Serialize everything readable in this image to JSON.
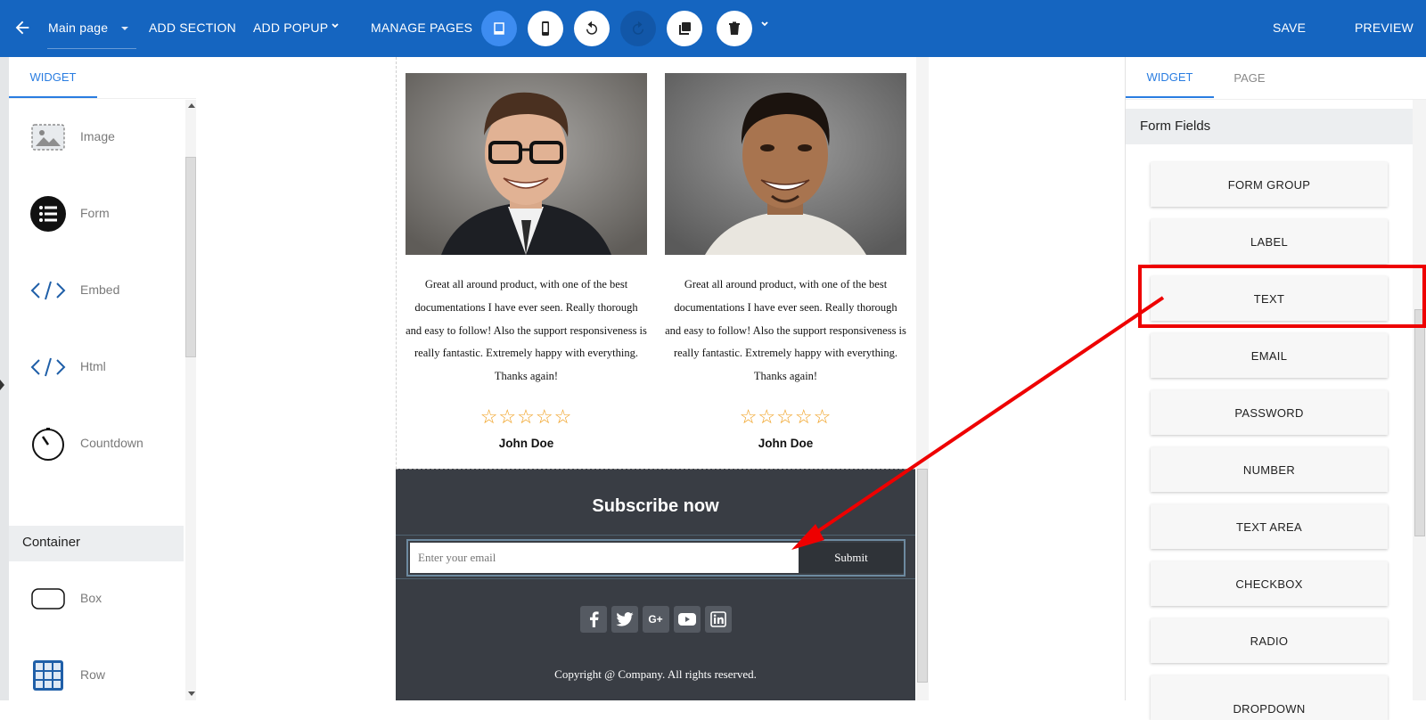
{
  "toolbar": {
    "page_select": "Main page",
    "add_section": "ADD SECTION",
    "add_popup": "ADD POPUP",
    "manage_pages": "MANAGE PAGES",
    "save": "SAVE",
    "preview": "PREVIEW"
  },
  "left_panel": {
    "tab": "WIDGET",
    "widgets": [
      {
        "label": "Image",
        "icon": "image-icon"
      },
      {
        "label": "Form",
        "icon": "form-list-icon"
      },
      {
        "label": "Embed",
        "icon": "code-icon"
      },
      {
        "label": "Html",
        "icon": "code-icon"
      },
      {
        "label": "Countdown",
        "icon": "timer-icon"
      }
    ],
    "container_heading": "Container",
    "container_items": [
      {
        "label": "Box",
        "icon": "box-icon"
      },
      {
        "label": "Row",
        "icon": "grid-icon"
      }
    ]
  },
  "canvas": {
    "testimonials": [
      {
        "text": "Great all around product, with one of the best documentations I have ever seen. Really thorough and easy to follow! Also the support responsiveness is really fantastic. Extremely happy with everything. Thanks again!",
        "stars": "☆☆☆☆☆",
        "name": "John Doe"
      },
      {
        "text": "Great all around product, with one of the best documentations I have ever seen. Really thorough and easy to follow! Also the support responsiveness is really fantastic. Extremely happy with everything. Thanks again!",
        "stars": "☆☆☆☆☆",
        "name": "John Doe"
      }
    ],
    "subscribe": {
      "title": "Subscribe now",
      "email_placeholder": "Enter your email",
      "submit": "Submit",
      "socials": [
        "facebook-icon",
        "twitter-icon",
        "google-plus-icon",
        "youtube-icon",
        "linkedin-icon"
      ],
      "google_plus_text": "G+",
      "copyright": "Copyright @ Company. All rights reserved."
    }
  },
  "right_panel": {
    "tabs": [
      "WIDGET",
      "PAGE"
    ],
    "heading": "Form Fields",
    "fields": [
      "FORM GROUP",
      "LABEL",
      "TEXT",
      "EMAIL",
      "PASSWORD",
      "NUMBER",
      "TEXT AREA",
      "CHECKBOX",
      "RADIO",
      "DROPDOWN"
    ]
  },
  "colors": {
    "toolbar": "#1565c0",
    "accent": "#2a7de1",
    "annotation": "#ee0000",
    "footer": "#393d44",
    "stars": "#f0a020"
  }
}
